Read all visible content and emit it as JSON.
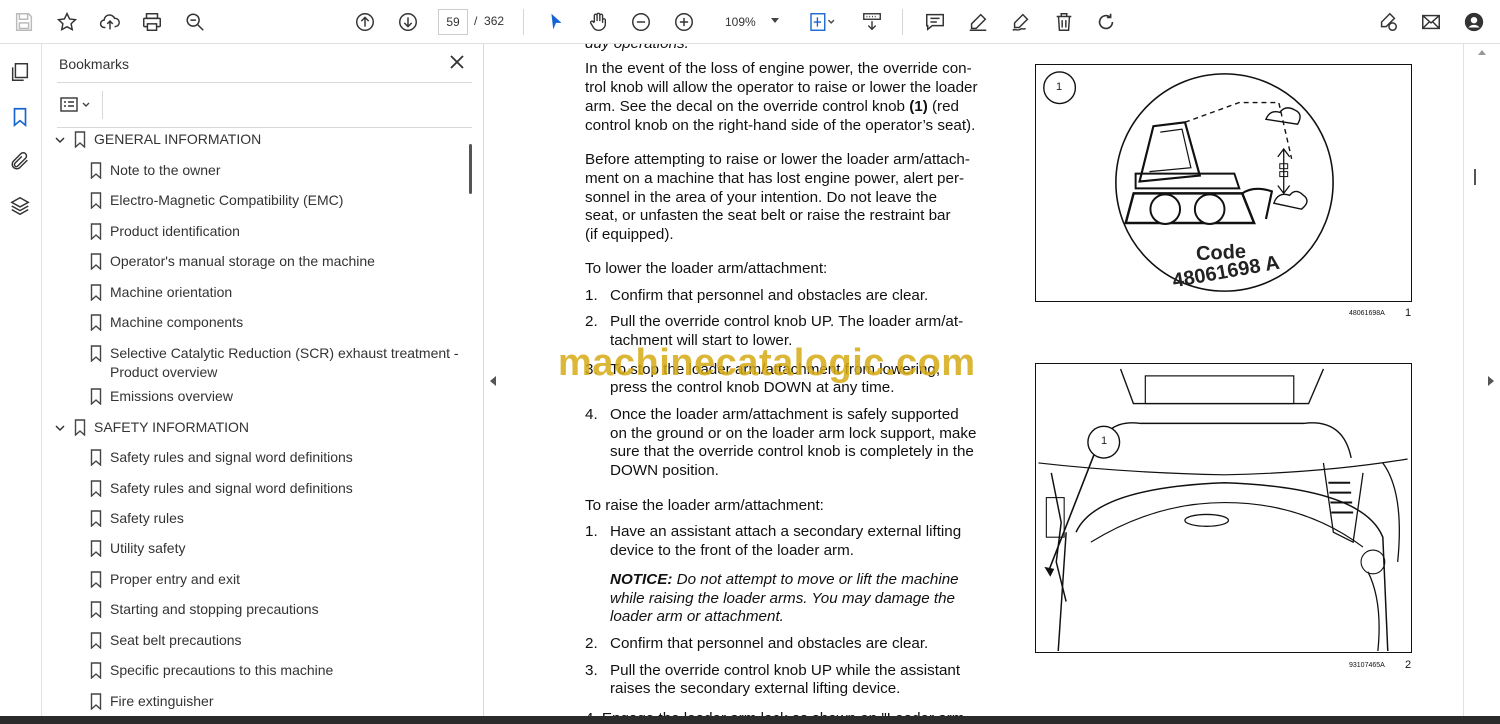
{
  "toolbar": {
    "page_current": "59",
    "page_separator": "/",
    "page_total": "362",
    "zoom": "109%"
  },
  "bookmarks": {
    "title": "Bookmarks",
    "items": [
      {
        "label": "GENERAL INFORMATION",
        "level": 0,
        "expanded": true
      },
      {
        "label": "Note to the owner",
        "level": 1
      },
      {
        "label": "Electro-Magnetic Compatibility (EMC)",
        "level": 1
      },
      {
        "label": "Product identification",
        "level": 1
      },
      {
        "label": "Operator's manual storage on the machine",
        "level": 1
      },
      {
        "label": "Machine orientation",
        "level": 1
      },
      {
        "label": "Machine components",
        "level": 1
      },
      {
        "label": "Selective Catalytic Reduction (SCR) exhaust treatment -",
        "label2": "Product overview",
        "level": 1
      },
      {
        "label": "Emissions overview",
        "level": 1
      },
      {
        "label": "SAFETY INFORMATION",
        "level": 0,
        "expanded": true
      },
      {
        "label": "Safety rules and signal word definitions",
        "level": 1
      },
      {
        "label": "Safety rules and signal word definitions",
        "level": 1
      },
      {
        "label": "Safety rules",
        "level": 1
      },
      {
        "label": "Utility safety",
        "level": 1
      },
      {
        "label": "Proper entry and exit",
        "level": 1
      },
      {
        "label": "Starting and stopping precautions",
        "level": 1
      },
      {
        "label": "Seat belt precautions",
        "level": 1
      },
      {
        "label": "Specific precautions to this machine",
        "level": 1
      },
      {
        "label": "Fire extinguisher",
        "level": 1
      }
    ]
  },
  "document": {
    "top_cut": "duy operations.",
    "para1": [
      "In the event of the loss of engine power, the override con-",
      "trol knob will allow the operator to raise or lower the loader",
      "arm.  See the decal on the override control knob ",
      "(1)",
      " (red",
      "control knob on the right-hand side of the operator’s seat)."
    ],
    "para2": [
      "Before attempting to raise or lower the loader arm/attach-",
      "ment on a machine that has lost engine power, alert per-",
      "sonnel in the area of your intention.  Do not leave the",
      "seat, or unfasten the seat belt or raise the restraint bar",
      "(if equipped)."
    ],
    "lower_heading": "To lower the loader arm/attachment:",
    "lower_steps": [
      {
        "n": "1.",
        "lines": [
          "Confirm that personnel and obstacles are clear."
        ]
      },
      {
        "n": "2.",
        "lines": [
          "Pull the override control knob UP. The loader arm/at-",
          "tachment will start to lower."
        ]
      },
      {
        "n": "3.",
        "lines": [
          "To stop the loader arm/attachment from lowering,",
          "press the control knob DOWN at any time."
        ]
      },
      {
        "n": "4.",
        "lines": [
          "Once the loader arm/attachment is safely supported",
          "on the ground or on the loader arm lock support, make",
          "sure that the override control knob is completely in the",
          "DOWN position."
        ]
      }
    ],
    "raise_heading": "To raise the loader arm/attachment:",
    "raise_steps": [
      {
        "n": "1.",
        "lines": [
          "Have an assistant attach a secondary external lifting",
          "device to the front of the loader arm."
        ]
      },
      {
        "n": "2.",
        "lines": [
          "Confirm that personnel and obstacles are clear."
        ]
      },
      {
        "n": "3.",
        "lines": [
          "Pull the override control knob UP while the assistant",
          "raises the secondary external lifting device."
        ]
      }
    ],
    "notice_label": "NOTICE:",
    "notice_lines": [
      " Do not attempt to move or lift the machine",
      "while raising the loader arms.  You may damage the",
      "loader arm or attachment."
    ],
    "bottom_cut": "4.   Engage the loader arm lock as shown on \"Loader arm",
    "figure1": {
      "callout": "1",
      "code_label": "Code",
      "code_value": "48061698 A",
      "caption": "48061698A",
      "number": "1"
    },
    "figure2": {
      "callout": "1",
      "caption": "93107465A",
      "number": "2"
    },
    "watermark": "machinecatalogic.com"
  }
}
